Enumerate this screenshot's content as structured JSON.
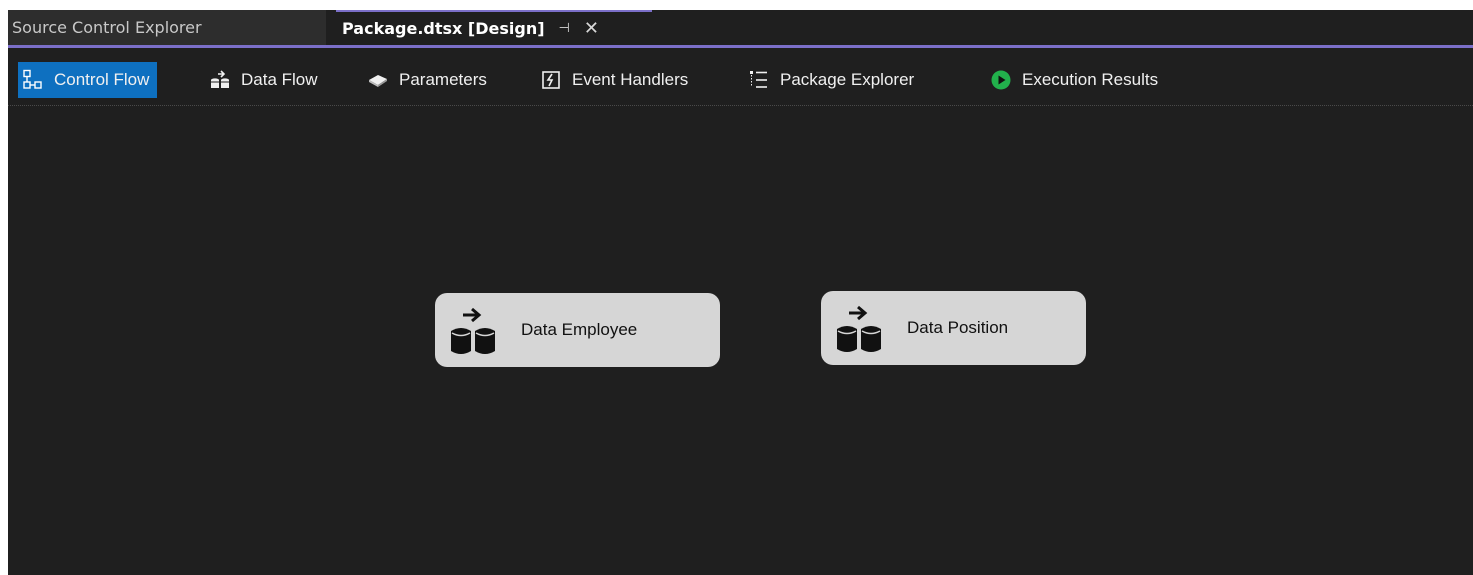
{
  "tabs": {
    "inactive": {
      "label": "Source Control Explorer"
    },
    "active": {
      "label": "Package.dtsx [Design]",
      "pin": "⊣",
      "close": "✕"
    }
  },
  "designer_tabs": [
    {
      "label": "Control Flow",
      "icon": "control-flow-icon",
      "selected": true
    },
    {
      "label": "Data Flow",
      "icon": "data-flow-icon",
      "selected": false
    },
    {
      "label": "Parameters",
      "icon": "parameters-icon",
      "selected": false
    },
    {
      "label": "Event Handlers",
      "icon": "event-handlers-icon",
      "selected": false
    },
    {
      "label": "Package Explorer",
      "icon": "package-explorer-icon",
      "selected": false
    },
    {
      "label": "Execution Results",
      "icon": "execution-results-icon",
      "selected": false
    }
  ],
  "tasks": [
    {
      "label": "Data Employee",
      "icon": "data-flow-task-icon"
    },
    {
      "label": "Data Position",
      "icon": "data-flow-task-icon"
    }
  ],
  "colors": {
    "background": "#1f1f1f",
    "accent": "#7b6fc8",
    "selected_tab": "#0e70c0",
    "task_box": "#d6d6d6",
    "execution_icon": "#22b14c"
  }
}
